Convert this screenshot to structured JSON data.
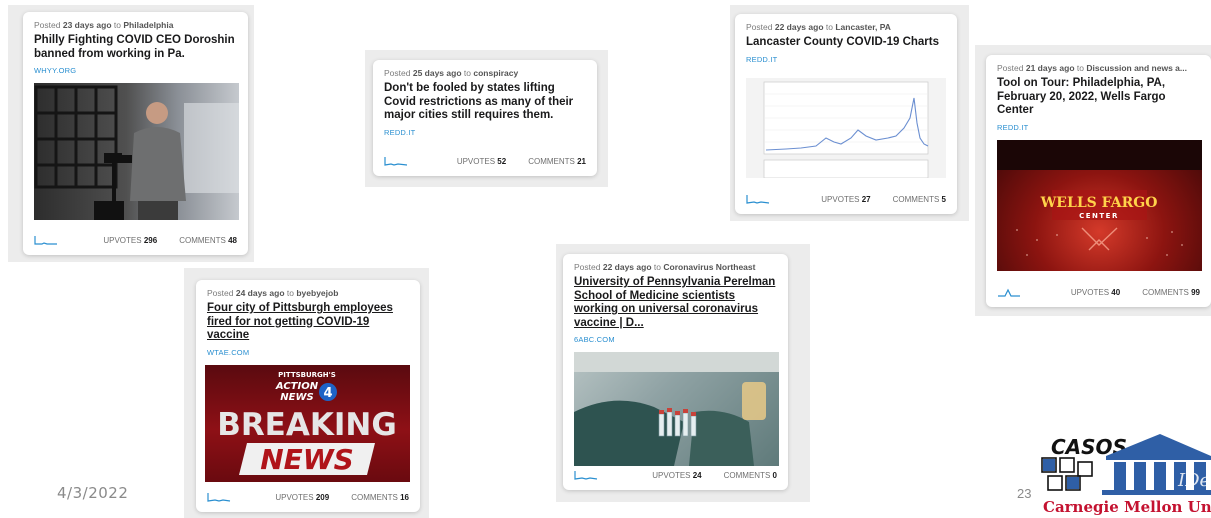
{
  "posts": [
    {
      "posted_prefix": "Posted",
      "age": "23 days ago",
      "to": "to",
      "community": "Philadelphia",
      "title": "Philly Fighting COVID CEO Doroshin banned from working in Pa.",
      "domain": "WHYY.ORG",
      "upvotes_label": "UPVOTES",
      "upvotes": "296",
      "comments_label": "COMMENTS",
      "comments": "48"
    },
    {
      "posted_prefix": "Posted",
      "age": "25 days ago",
      "to": "to",
      "community": "conspiracy",
      "title": "Don't be fooled by states lifting Covid restrictions as many of their major cities still requires them.",
      "domain": "REDD.IT",
      "upvotes_label": "UPVOTES",
      "upvotes": "52",
      "comments_label": "COMMENTS",
      "comments": "21"
    },
    {
      "posted_prefix": "Posted",
      "age": "22 days ago",
      "to": "to",
      "community": "Lancaster, PA",
      "title": "Lancaster County COVID-19 Charts",
      "domain": "REDD.IT",
      "upvotes_label": "UPVOTES",
      "upvotes": "27",
      "comments_label": "COMMENTS",
      "comments": "5"
    },
    {
      "posted_prefix": "Posted",
      "age": "21 days ago",
      "to": "to",
      "community": "Discussion and news a...",
      "title": "Tool on Tour: Philadelphia, PA, February 20, 2022, Wells Fargo Center",
      "domain": "REDD.IT",
      "upvotes_label": "UPVOTES",
      "upvotes": "40",
      "comments_label": "COMMENTS",
      "comments": "99",
      "thumb_text": [
        "WELLS FARGO",
        "CENTER"
      ]
    },
    {
      "posted_prefix": "Posted",
      "age": "24 days ago",
      "to": "to",
      "community": "byebyejob",
      "title": "Four city of Pittsburgh employees fired for not getting COVID-19 vaccine",
      "domain": "WTAE.COM",
      "upvotes_label": "UPVOTES",
      "upvotes": "209",
      "comments_label": "COMMENTS",
      "comments": "16",
      "thumb_text": [
        "PITTSBURGH'S",
        "ACTION",
        "NEWS",
        "4",
        "BREAKING",
        "NEWS"
      ]
    },
    {
      "posted_prefix": "Posted",
      "age": "22 days ago",
      "to": "to",
      "community": "Coronavirus Northeast",
      "title": "University of Pennsylvania Perelman School of Medicine scientists working on universal coronavirus vaccine | D...",
      "domain": "6ABC.COM",
      "upvotes_label": "UPVOTES",
      "upvotes": "24",
      "comments_label": "COMMENTS",
      "comments": "0"
    }
  ],
  "slide": {
    "date": "4/3/2022",
    "number": "23"
  },
  "logo": {
    "top": "CASOS",
    "side": "IDeaS",
    "bottom": "Carnegie Mellon Univer"
  },
  "colors": {
    "link": "#2a8fd0",
    "cmu_red": "#c41230",
    "logo_blue": "#2f5fa6"
  }
}
